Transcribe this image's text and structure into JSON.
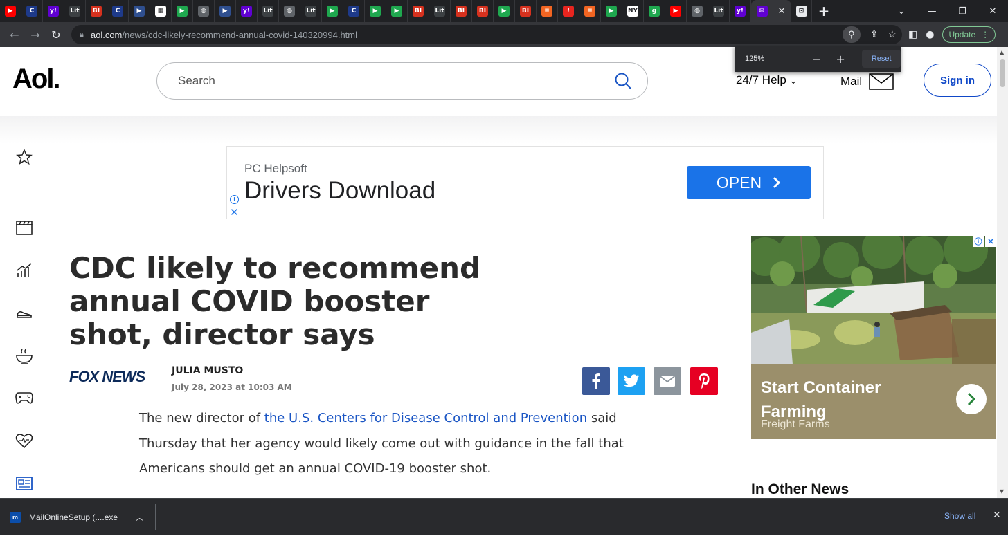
{
  "browser": {
    "tabs": [
      {
        "icon": "youtube-icon",
        "color": "#ff0000",
        "glyph": "▶"
      },
      {
        "icon": "c-icon",
        "color": "#1e3a8a",
        "glyph": "C"
      },
      {
        "icon": "yahoo-icon",
        "color": "#6001d2",
        "glyph": "y!"
      },
      {
        "icon": "lit-icon",
        "color": "#3c4043",
        "glyph": "Lit"
      },
      {
        "icon": "bi-icon",
        "color": "#d6311e",
        "glyph": "BI"
      },
      {
        "icon": "c-icon",
        "color": "#1e3a8a",
        "glyph": "C"
      },
      {
        "icon": "arrow-icon",
        "color": "#2f4f8f",
        "glyph": "▶"
      },
      {
        "icon": "grid-icon",
        "color": "#ffffff",
        "glyph": "▦"
      },
      {
        "icon": "play-icon",
        "color": "#1fa84f",
        "glyph": "▶"
      },
      {
        "icon": "globe-icon",
        "color": "#5f6368",
        "glyph": "◍"
      },
      {
        "icon": "arrow-icon",
        "color": "#2f4f8f",
        "glyph": "▶"
      },
      {
        "icon": "yahoo-icon",
        "color": "#6001d2",
        "glyph": "y!"
      },
      {
        "icon": "lit-icon",
        "color": "#3c4043",
        "glyph": "Lit"
      },
      {
        "icon": "globe-icon",
        "color": "#5f6368",
        "glyph": "◍"
      },
      {
        "icon": "lit-icon",
        "color": "#3c4043",
        "glyph": "Lit"
      },
      {
        "icon": "play-icon",
        "color": "#1fa84f",
        "glyph": "▶"
      },
      {
        "icon": "c-icon",
        "color": "#1e3a8a",
        "glyph": "C"
      },
      {
        "icon": "play-icon",
        "color": "#1fa84f",
        "glyph": "▶"
      },
      {
        "icon": "play-icon",
        "color": "#1fa84f",
        "glyph": "▶"
      },
      {
        "icon": "bi-icon",
        "color": "#d6311e",
        "glyph": "BI"
      },
      {
        "icon": "lit-icon",
        "color": "#3c4043",
        "glyph": "Lit"
      },
      {
        "icon": "bi-icon",
        "color": "#d6311e",
        "glyph": "BI"
      },
      {
        "icon": "bi-icon",
        "color": "#d6311e",
        "glyph": "BI"
      },
      {
        "icon": "play-icon",
        "color": "#1fa84f",
        "glyph": "▶"
      },
      {
        "icon": "bi-icon",
        "color": "#d6311e",
        "glyph": "BI"
      },
      {
        "icon": "bookmark-icon",
        "color": "#f26522",
        "glyph": "≡"
      },
      {
        "icon": "bookmark-icon",
        "color": "#e8251f",
        "glyph": "!"
      },
      {
        "icon": "bookmark-icon",
        "color": "#f26522",
        "glyph": "≡"
      },
      {
        "icon": "play-icon",
        "color": "#1fa84f",
        "glyph": "▶"
      },
      {
        "icon": "nyt-icon",
        "color": "#ffffff",
        "glyph": "NY"
      },
      {
        "icon": "g-icon",
        "color": "#1fa84f",
        "glyph": "g"
      },
      {
        "icon": "youtube-icon",
        "color": "#ff0000",
        "glyph": "▶"
      },
      {
        "icon": "globe-icon",
        "color": "#5f6368",
        "glyph": "◍"
      },
      {
        "icon": "lit-icon",
        "color": "#3c4043",
        "glyph": "Lit"
      },
      {
        "icon": "yahoo-icon",
        "color": "#6001d2",
        "glyph": "y!"
      }
    ],
    "url_host": "aol.com",
    "url_path": "/news/cdc-likely-recommend-annual-covid-140320994.html",
    "update_label": "Update",
    "zoom": {
      "level": "125%",
      "reset_label": "Reset"
    }
  },
  "header": {
    "logo": "Aol.",
    "search_placeholder": "Search",
    "help_label": "24/7 Help",
    "mail_label": "Mail",
    "signin_label": "Sign in"
  },
  "top_ad": {
    "brand": "PC Helpsoft",
    "headline": "Drivers Download",
    "cta": "OPEN"
  },
  "article": {
    "headline": "CDC likely to recommend annual COVID booster shot, director says",
    "source": "FOX NEWS",
    "author": "JULIA MUSTO",
    "date": "July 28, 2023 at 10:03 AM",
    "body_before_link": "The new director of ",
    "body_link": "the U.S. Centers for Disease Control and Prevention",
    "body_after_link": " said Thursday that her agency would likely come out with guidance in the fall that Americans should get an annual COVID-19 booster shot."
  },
  "share": [
    {
      "name": "facebook",
      "color": "#3b5998",
      "glyph": "f"
    },
    {
      "name": "twitter",
      "color": "#1da1f2",
      "glyph": "t"
    },
    {
      "name": "email",
      "color": "#8c959d",
      "glyph": "✉"
    },
    {
      "name": "pinterest",
      "color": "#e60023",
      "glyph": "P"
    }
  ],
  "side_ad": {
    "title": "Start Container Farming",
    "brand": "Freight Farms"
  },
  "other_news": "In Other News",
  "download": {
    "filename": "MailOnlineSetup (....exe",
    "show_all": "Show all"
  }
}
